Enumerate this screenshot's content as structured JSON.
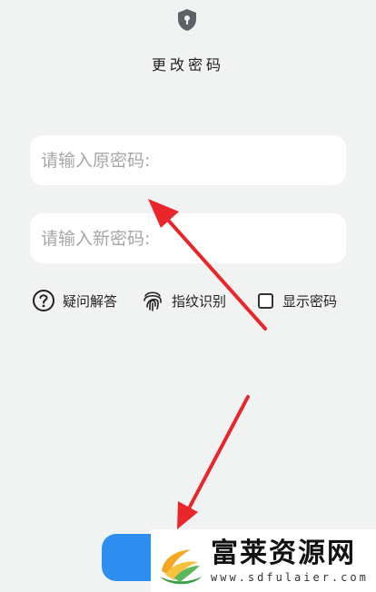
{
  "header": {
    "title": "更改密码",
    "icon": "shield-lock-icon"
  },
  "form": {
    "old_password": {
      "value": "",
      "placeholder": "请输入原密码:"
    },
    "new_password": {
      "value": "",
      "placeholder": "请输入新密码:"
    }
  },
  "options": {
    "security_question": {
      "label": "疑问解答",
      "icon": "question-circle-icon"
    },
    "fingerprint": {
      "label": "指纹识别",
      "icon": "fingerprint-icon"
    },
    "show_password": {
      "label": "显示密码",
      "checked": false
    }
  },
  "colors": {
    "background": "#f1f2f2",
    "submit_button": "#2e8ef0",
    "annotation_arrow": "#e8262b",
    "placeholder": "#a7a7a7"
  },
  "watermark": {
    "name": "富莱资源网",
    "url": "www.sdfulaier.com"
  }
}
